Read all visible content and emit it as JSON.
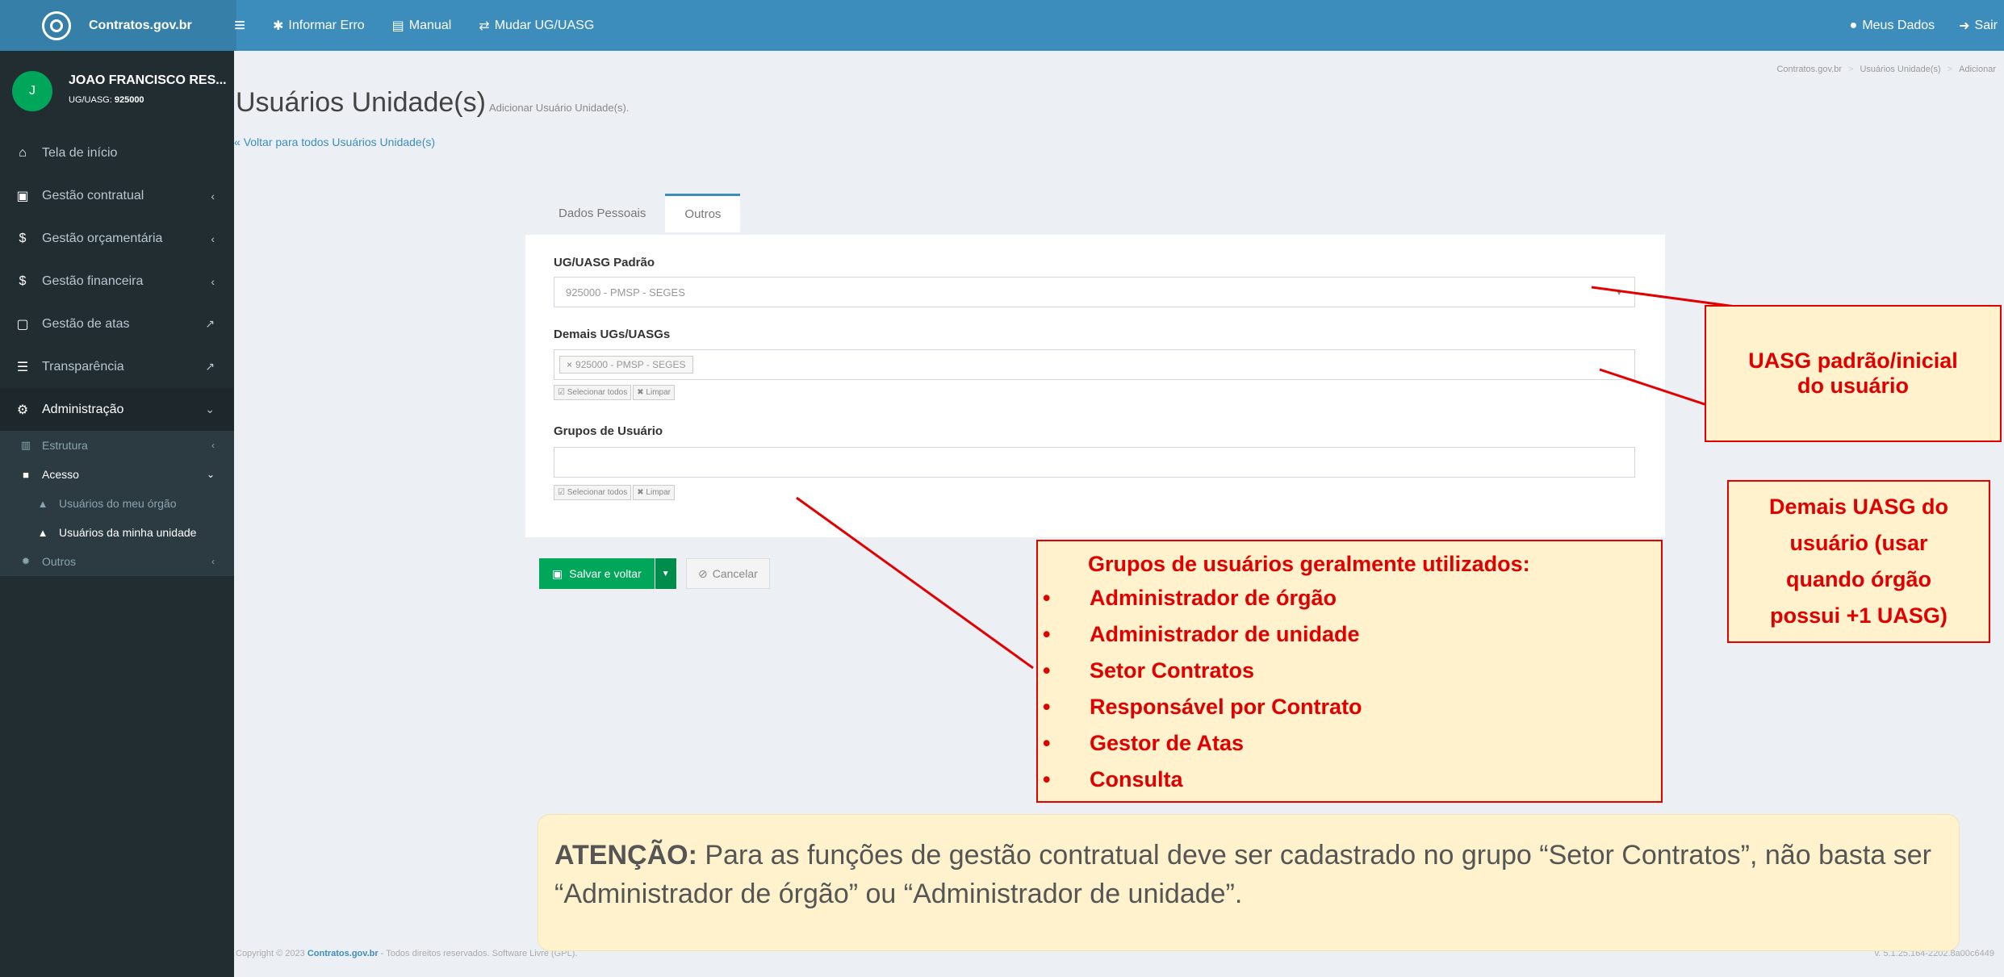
{
  "app": {
    "title": "Contratos.gov.br"
  },
  "topnav": {
    "informar_erro": "Informar Erro",
    "manual": "Manual",
    "mudar_ug": "Mudar UG/UASG",
    "meus_dados": "Meus Dados",
    "sair": "Sair"
  },
  "user": {
    "initial": "J",
    "name": "JOAO FRANCISCO RES...",
    "ug_label": "UG/UASG: ",
    "ug_value": "925000"
  },
  "sidebar": {
    "items": [
      {
        "label": "Tela de início",
        "icon": "home-icon"
      },
      {
        "label": "Gestão contratual",
        "icon": "document-icon"
      },
      {
        "label": "Gestão orçamentária",
        "icon": "dollar-icon"
      },
      {
        "label": "Gestão financeira",
        "icon": "dollar-icon"
      },
      {
        "label": "Gestão de atas",
        "icon": "file-icon"
      },
      {
        "label": "Transparência",
        "icon": "list-icon"
      },
      {
        "label": "Administração",
        "icon": "cogs-icon"
      }
    ],
    "sub": {
      "estrutura": "Estrutura",
      "acesso": "Acesso",
      "usuarios_orgao": "Usuários do meu órgão",
      "usuarios_unidade": "Usuários da minha unidade",
      "outros": "Outros"
    }
  },
  "page": {
    "title": "Usuários Unidade(s)",
    "subtitle": "Adicionar Usuário Unidade(s).",
    "back": "Voltar para todos Usuários Unidade(s)",
    "breadcrumb": [
      "Contratos.gov.br",
      "Usuários Unidade(s)",
      "Adicionar"
    ]
  },
  "tabs": {
    "dados": "Dados Pessoais",
    "outros": "Outros"
  },
  "form": {
    "ug_padrao_label": "UG/UASG Padrão",
    "ug_padrao_value": "925000 - PMSP - SEGES",
    "demais_label": "Demais UGs/UASGs",
    "demais_tag": "925000 - PMSP - SEGES",
    "selecionar_todos": "Selecionar todos",
    "limpar": "Limpar",
    "grupos_label": "Grupos de Usuário"
  },
  "buttons": {
    "salvar": "Salvar e voltar",
    "cancelar": "Cancelar"
  },
  "footer": {
    "copyright": "Copyright © 2023 ",
    "brand": "Contratos.gov.br",
    "rest": " - Todos direitos reservados. Software Livre (GPL).",
    "version": "v. 5.1.25.164-2202.8a00c6449"
  },
  "annotations": {
    "uasg_padrao": [
      "UASG padrão/inicial",
      "do usuário"
    ],
    "demais": [
      "Demais UASG do",
      "usuário (usar",
      "quando órgão",
      "possui +1 UASG)"
    ],
    "grupos_title": "Grupos de usuários geralmente utilizados:",
    "grupos": [
      "Administrador de órgão",
      "Administrador de unidade",
      "Setor Contratos",
      "Responsável por Contrato",
      "Gestor de Atas",
      "Consulta"
    ],
    "atencao_label": "ATENÇÃO:",
    "atencao_text": " Para as funções de gestão contratual deve ser cadastrado no grupo “Setor Contratos”, não basta ser “Administrador de órgão” ou “Administrador de unidade”."
  },
  "colors": {
    "primary": "#3c8dbc",
    "sidebar": "#222d32",
    "success": "#00a65a",
    "annotation_red": "#e30000",
    "annotation_bg": "#fff2cc"
  }
}
